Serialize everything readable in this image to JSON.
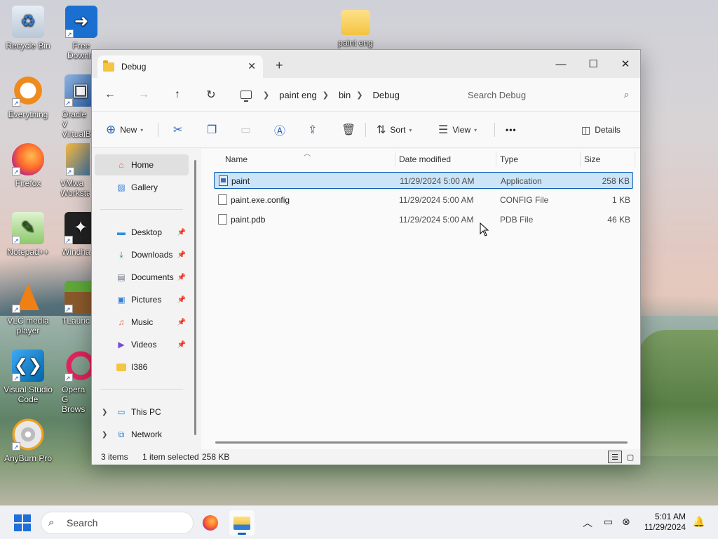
{
  "desktop": {
    "icons": [
      {
        "label": "Recycle Bin",
        "icon": "recycle-bin-icon"
      },
      {
        "label": "Free Downlo",
        "icon": "free-download-manager-icon"
      },
      {
        "label": "paint eng",
        "icon": "folder-icon"
      },
      {
        "label": "Everything",
        "icon": "everything-search-icon"
      },
      {
        "label": "Oracle V VirtualB",
        "icon": "virtualbox-icon"
      },
      {
        "label": "Firefox",
        "icon": "firefox-icon"
      },
      {
        "label": "VMwa Worksta",
        "icon": "vmware-icon"
      },
      {
        "label": "Notepad++",
        "icon": "notepad-plus-plus-icon"
      },
      {
        "label": "Windha",
        "icon": "windhawk-icon"
      },
      {
        "label": "VLC media player",
        "icon": "vlc-icon"
      },
      {
        "label": "TLaunc",
        "icon": "tlauncher-icon"
      },
      {
        "label": "Visual Studio Code",
        "icon": "vscode-icon"
      },
      {
        "label": "Opera G Brows",
        "icon": "opera-gx-icon"
      },
      {
        "label": "AnyBurn Pro",
        "icon": "anyburn-icon"
      }
    ]
  },
  "window": {
    "tab_title": "Debug",
    "new_tab": "+",
    "controls": {
      "minimize": "—",
      "maximize": "☐",
      "close": "✕"
    },
    "breadcrumb": [
      "paint eng",
      "bin",
      "Debug"
    ],
    "search_placeholder": "Search Debug",
    "toolbar": {
      "new_label": "New",
      "sort_label": "Sort",
      "view_label": "View",
      "more_label": "•••",
      "details_label": "Details"
    },
    "sidebar": {
      "home": "Home",
      "gallery": "Gallery",
      "pinned": [
        {
          "label": "Desktop",
          "icon": "desktop-icon",
          "color": "#2f8fd8"
        },
        {
          "label": "Downloads",
          "icon": "download-icon",
          "color": "#1a9a5a"
        },
        {
          "label": "Documents",
          "icon": "documents-icon",
          "color": "#6a7482"
        },
        {
          "label": "Pictures",
          "icon": "pictures-icon",
          "color": "#2f7fd8"
        },
        {
          "label": "Music",
          "icon": "music-icon",
          "color": "#e0614a"
        },
        {
          "label": "Videos",
          "icon": "videos-icon",
          "color": "#7a4ad8"
        },
        {
          "label": "I386",
          "icon": "folder-icon",
          "color": "#f4c542"
        }
      ],
      "this_pc": "This PC",
      "network": "Network"
    },
    "columns": {
      "name": "Name",
      "date": "Date modified",
      "type": "Type",
      "size": "Size"
    },
    "files": [
      {
        "name": "paint",
        "date": "11/29/2024 5:00 AM",
        "type": "Application",
        "size": "258 KB",
        "selected": true
      },
      {
        "name": "paint.exe.config",
        "date": "11/29/2024 5:00 AM",
        "type": "CONFIG File",
        "size": "1 KB",
        "selected": false
      },
      {
        "name": "paint.pdb",
        "date": "11/29/2024 5:00 AM",
        "type": "PDB File",
        "size": "46 KB",
        "selected": false
      }
    ],
    "status": {
      "count": "3 items",
      "selection": "1 item selected",
      "size": "258 KB"
    }
  },
  "taskbar": {
    "search_placeholder": "Search",
    "time": "5:01 AM",
    "date": "11/29/2024"
  },
  "colors": {
    "accent": "#0a64c8",
    "selection": "#cce4f7",
    "folder": "#f4c542"
  }
}
